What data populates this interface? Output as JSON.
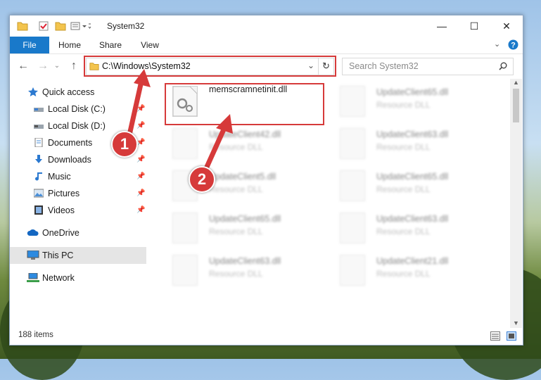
{
  "window": {
    "title": "System32",
    "controls": {
      "minimize": "—",
      "maximize": "☐",
      "close": "✕"
    }
  },
  "ribbon": {
    "tabs": [
      {
        "label": "File",
        "active": true
      },
      {
        "label": "Home"
      },
      {
        "label": "Share"
      },
      {
        "label": "View"
      }
    ]
  },
  "nav": {
    "address": "C:\\Windows\\System32",
    "search_placeholder": "Search System32"
  },
  "sidebar": {
    "items": [
      {
        "label": "Quick access",
        "icon": "star-icon"
      },
      {
        "label": "Local Disk (C:)",
        "icon": "drive-icon",
        "pinned": true
      },
      {
        "label": "Local Disk (D:)",
        "icon": "drive-icon",
        "pinned": true
      },
      {
        "label": "Documents",
        "icon": "documents-icon",
        "pinned": true
      },
      {
        "label": "Downloads",
        "icon": "downloads-icon",
        "pinned": true
      },
      {
        "label": "Music",
        "icon": "music-icon",
        "pinned": true
      },
      {
        "label": "Pictures",
        "icon": "pictures-icon",
        "pinned": true
      },
      {
        "label": "Videos",
        "icon": "videos-icon",
        "pinned": true
      },
      {
        "label": "OneDrive",
        "icon": "onedrive-icon"
      },
      {
        "label": "This PC",
        "icon": "pc-icon",
        "selected": true
      },
      {
        "label": "Network",
        "icon": "network-icon"
      }
    ]
  },
  "files": [
    {
      "name": "memscramnetinit.dll",
      "type": ""
    },
    {
      "name": "UpdateClient65.dll",
      "type": "Resource DLL"
    },
    {
      "name": "UpdateClient42.dll",
      "type": "Resource DLL"
    },
    {
      "name": "UpdateClient63.dll",
      "type": "Resource DLL"
    },
    {
      "name": "UpdateClient5.dll",
      "type": "Resource DLL"
    },
    {
      "name": "UpdateClient65.dll",
      "type": "Resource DLL"
    },
    {
      "name": "UpdateClient65.dll",
      "type": "Resource DLL"
    },
    {
      "name": "UpdateClient63.dll",
      "type": "Resource DLL"
    },
    {
      "name": "UpdateClient63.dll",
      "type": "Resource DLL"
    },
    {
      "name": "UpdateClient21.dll",
      "type": "Resource DLL"
    }
  ],
  "status": {
    "count": "188 items"
  },
  "annotations": {
    "marker1": "1",
    "marker2": "2"
  },
  "colors": {
    "accent": "#1979ca",
    "highlight": "#d63a3a",
    "selected": "#e5e5e5"
  }
}
